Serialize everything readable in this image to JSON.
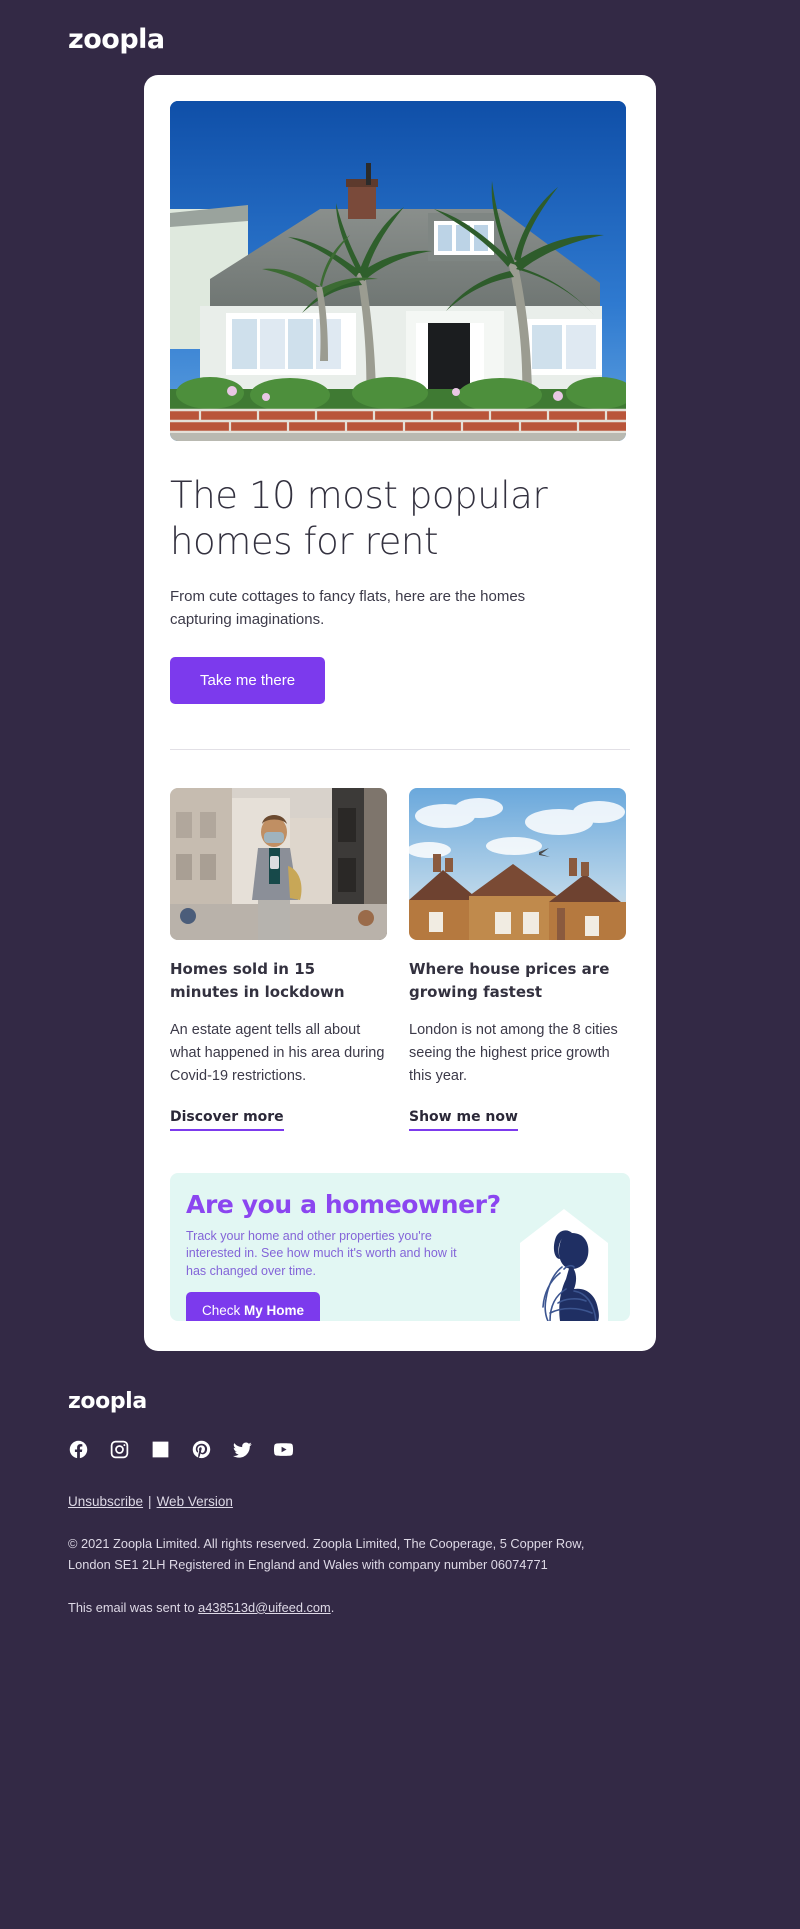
{
  "brand": {
    "logo_text": "zoopla",
    "accent_purple": "#7c3aed",
    "background": "#332945",
    "promo_bg": "#e2f7f3",
    "promo_title_color": "#8b46f0"
  },
  "header": {
    "logo_text": "zoopla"
  },
  "hero": {
    "image_alt": "white bungalow with palm trees and brick garden wall under blue sky",
    "headline": "The 10 most popular homes for rent",
    "lede": "From cute cottages to fancy flats, here are the homes capturing imaginations.",
    "cta_label": "Take me there"
  },
  "articles": [
    {
      "image_alt": "man wearing face mask looking at phone on a city street",
      "title": "Homes sold in 15 minutes in lockdown",
      "body": "An estate agent tells all about what happened in his area during Covid-19 restrictions.",
      "link_label": "Discover more"
    },
    {
      "image_alt": "row of brick terraced house rooftops against a cloudy sky",
      "title": "Where house prices are growing fastest",
      "body": "London is not among the 8 cities seeing the highest price growth this year.",
      "link_label": "Show me now"
    }
  ],
  "promo": {
    "title": "Are you a homeowner?",
    "body": "Track your home and other properties you're interested in. See how much it's worth and how it has changed over time.",
    "cta_prefix": "Check ",
    "cta_bold": "My Home",
    "illustration_alt": "line drawing of a seated person inside a house outline"
  },
  "footer": {
    "logo_text": "zoopla",
    "socials": [
      {
        "name": "facebook-icon",
        "label": "Facebook"
      },
      {
        "name": "instagram-icon",
        "label": "Instagram"
      },
      {
        "name": "linkedin-icon",
        "label": "LinkedIn"
      },
      {
        "name": "pinterest-icon",
        "label": "Pinterest"
      },
      {
        "name": "twitter-icon",
        "label": "Twitter"
      },
      {
        "name": "youtube-icon",
        "label": "YouTube"
      }
    ],
    "unsubscribe_label": "Unsubscribe",
    "separator": "|",
    "web_version_label": "Web Version",
    "legal": "© 2021 Zoopla Limited. All rights reserved. Zoopla Limited, The Cooperage, 5 Copper Row, London SE1 2LH Registered in England and Wales with company number 06074771",
    "sent_to_prefix": "This email was sent to ",
    "sent_to_email": "a438513d@uifeed.com",
    "sent_to_suffix": "."
  }
}
